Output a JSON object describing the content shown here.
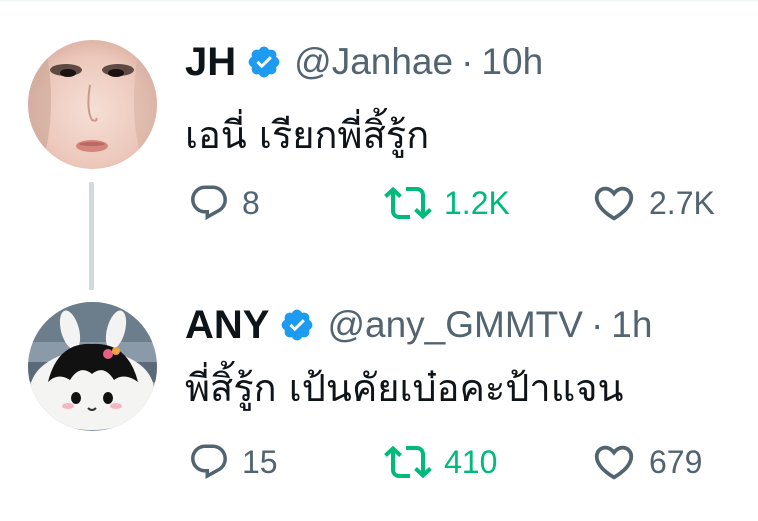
{
  "colors": {
    "verified": "#1d9bf0",
    "muted": "#536471",
    "retweet_active": "#00ba7c",
    "thread_line": "#cfd9de"
  },
  "tweets": [
    {
      "display_name": "JH",
      "handle": "@Janhae",
      "separator": "·",
      "time": "10h",
      "text": "เอนี่ เรียกพี่สิ้รู้ก",
      "replies": "8",
      "retweets": "1.2K",
      "likes": "2.7K",
      "avatar_icon": "user-avatar-photo",
      "verified_icon": "verified-badge-icon"
    },
    {
      "display_name": "ANY",
      "handle": "@any_GMMTV",
      "separator": "·",
      "time": "1h",
      "text": "พี่สิ้รู้ก เป้นคัยเบ๋อคะป้าแจน",
      "replies": "15",
      "retweets": "410",
      "likes": "679",
      "avatar_icon": "plush-bunny-avatar",
      "verified_icon": "verified-badge-icon"
    }
  ]
}
